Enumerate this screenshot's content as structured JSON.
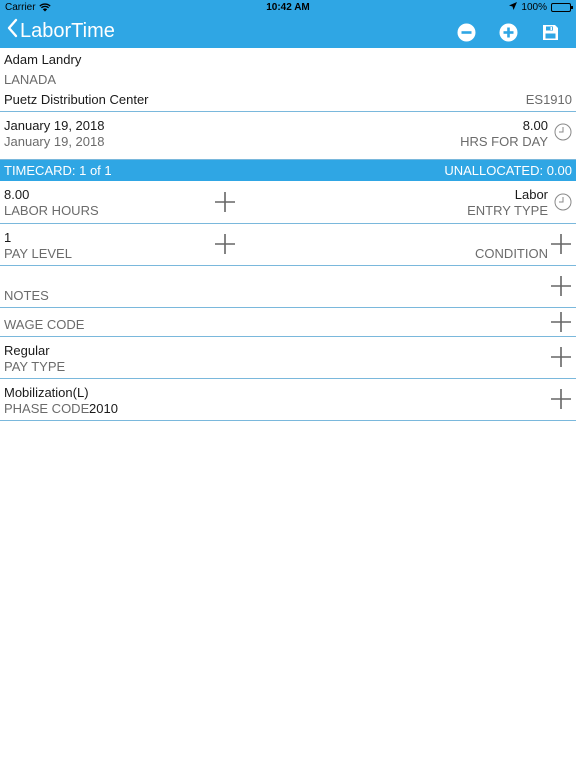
{
  "status_bar": {
    "carrier": "Carrier",
    "time": "10:42 AM",
    "battery": "100%"
  },
  "nav": {
    "back_label": "LaborTime",
    "icons": [
      "minus-circle-icon",
      "plus-circle-icon",
      "save-icon"
    ]
  },
  "employee": {
    "name": "Adam Landry",
    "location": "LANADA",
    "site": "Puetz Distribution Center",
    "site_code": "ES1910"
  },
  "date_row": {
    "date_value": "January 19, 2018",
    "date_label": "January 19, 2018",
    "hours_value": "8.00",
    "hours_label": "HRS FOR DAY"
  },
  "timecard": {
    "title": "TIMECARD:  1 of 1",
    "unallocated": "UNALLOCATED:  0.00"
  },
  "fields": {
    "labor_hours": {
      "value": "8.00",
      "label": "LABOR HOURS"
    },
    "entry_type": {
      "value": "Labor",
      "label": "ENTRY TYPE"
    },
    "pay_level": {
      "value": "1",
      "label": "PAY LEVEL"
    },
    "condition": {
      "label": "CONDITION"
    },
    "notes": {
      "label": "NOTES"
    },
    "wage_code": {
      "label": "WAGE CODE"
    },
    "pay_type": {
      "value": "Regular",
      "label": "PAY TYPE"
    },
    "phase_code": {
      "value": "Mobilization(L)",
      "label": "PHASE CODE",
      "code": "2010"
    }
  },
  "colors": {
    "accent": "#2fa6e4",
    "divider": "#7ab8dc",
    "label": "#6b6b6b"
  }
}
